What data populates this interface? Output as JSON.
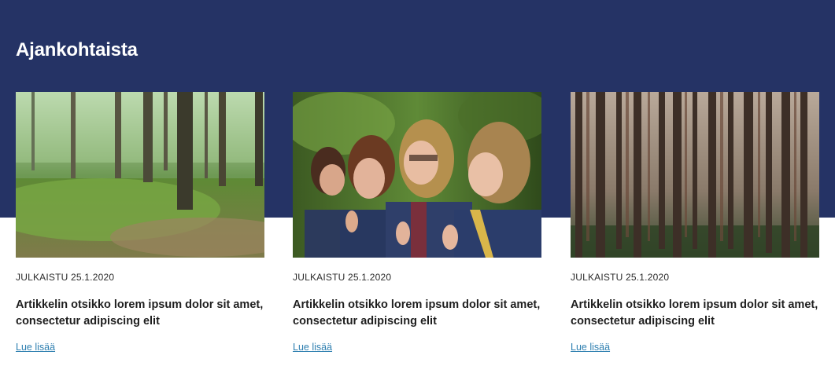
{
  "section": {
    "title": "Ajankohtaista"
  },
  "colors": {
    "band": "#253365",
    "link": "#2e7fb0"
  },
  "articles": [
    {
      "image": "forest-clearing-photo",
      "published": "JULKAISTU 25.1.2020",
      "title": "Artikkelin otsikko lorem ipsum dolor sit amet, consectetur adipiscing elit",
      "link": "Lue lisää"
    },
    {
      "image": "scouts-group-photo",
      "published": "JULKAISTU 25.1.2020",
      "title": "Artikkelin otsikko lorem ipsum dolor sit amet, consectetur adipiscing elit",
      "link": "Lue lisää"
    },
    {
      "image": "pine-forest-photo",
      "published": "JULKAISTU 25.1.2020",
      "title": "Artikkelin otsikko lorem ipsum dolor sit amet, consectetur adipiscing elit",
      "link": "Lue lisää"
    }
  ]
}
